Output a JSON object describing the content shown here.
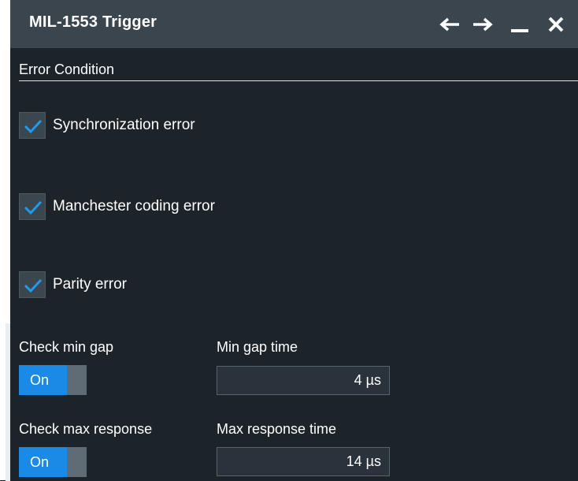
{
  "window": {
    "title": "MIL-1553 Trigger",
    "icons": [
      "arrow-left-icon",
      "arrow-right-icon",
      "minimize-icon",
      "close-icon"
    ]
  },
  "section": {
    "title": "Error Condition"
  },
  "checkboxes": [
    {
      "label": "Synchronization error",
      "checked": true
    },
    {
      "label": "Manchester coding error",
      "checked": true
    },
    {
      "label": "Parity error",
      "checked": true
    }
  ],
  "min_gap": {
    "check_label": "Check min gap",
    "toggle_label": "On",
    "time_label": "Min gap time",
    "time_value": "4 µs"
  },
  "max_response": {
    "check_label": "Check max response",
    "toggle_label": "On",
    "time_label": "Max response time",
    "time_value": "14 µs"
  },
  "colors": {
    "background": "#1c2329",
    "titlebar": "#3a454e",
    "accent": "#1a8ae6",
    "checkmark": "#1e9bf0"
  }
}
